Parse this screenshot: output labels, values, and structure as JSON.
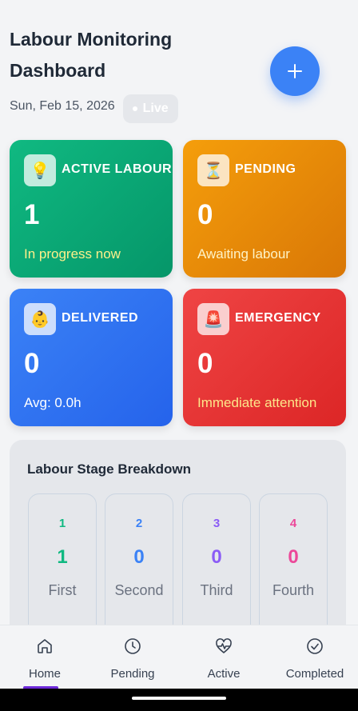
{
  "header": {
    "title": "Labour Monitoring Dashboard",
    "date": "Sun, Feb 15, 2026",
    "live_label": "Live"
  },
  "colors": {
    "accent": "#3b82f6",
    "active": "#10b981",
    "pending": "#f59e0b",
    "delivered": "#3b82f6",
    "emergency": "#ef4444"
  },
  "cards": [
    {
      "icon": "lightbulb-icon",
      "label": "ACTIVE LABOUR",
      "value": "1",
      "sub": "In progress now"
    },
    {
      "icon": "hourglass-icon",
      "label": "PENDING",
      "value": "0",
      "sub": "Awaiting labour"
    },
    {
      "icon": "baby-icon",
      "label": "DELIVERED",
      "value": "0",
      "sub": "Avg: 0.0h"
    },
    {
      "icon": "siren-icon",
      "label": "EMERGENCY",
      "value": "0",
      "sub": "Immediate attention"
    }
  ],
  "breakdown": {
    "title": "Labour Stage Breakdown",
    "stages": [
      {
        "num": "1",
        "count": "1",
        "name": "First",
        "color": "#10b981"
      },
      {
        "num": "2",
        "count": "0",
        "name": "Second",
        "color": "#3b82f6"
      },
      {
        "num": "3",
        "count": "0",
        "name": "Third",
        "color": "#8b5cf6"
      },
      {
        "num": "4",
        "count": "0",
        "name": "Fourth",
        "color": "#ec4899"
      }
    ]
  },
  "tabs": [
    {
      "label": "Home",
      "icon": "home-icon",
      "active": true
    },
    {
      "label": "Pending",
      "icon": "clock-icon",
      "active": false
    },
    {
      "label": "Active",
      "icon": "heart-pulse-icon",
      "active": false
    },
    {
      "label": "Completed",
      "icon": "check-circle-icon",
      "active": false
    }
  ]
}
